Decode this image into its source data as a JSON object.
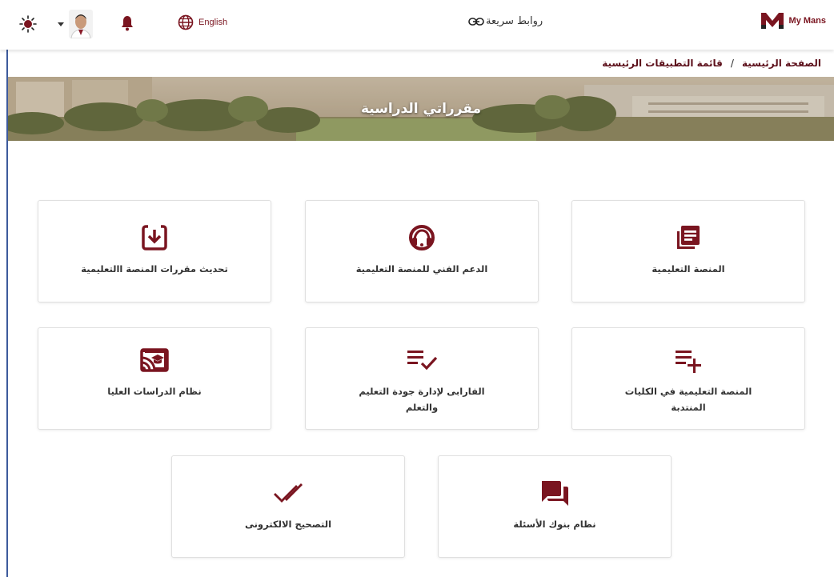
{
  "header": {
    "language_label": "English",
    "quick_links_label": "روابط سريعة",
    "logo_text": "My Mans",
    "icons": [
      "sun-icon",
      "avatar",
      "bell-icon",
      "globe-icon",
      "link-icon"
    ]
  },
  "breadcrumb": {
    "home": "الصفحة الرئيسية",
    "separator": "/",
    "current": "قائمة التطبيقات الرئيسية"
  },
  "banner": {
    "title": "مقرراتي الدراسية"
  },
  "cards": [
    {
      "label": "المنصة التعليمية",
      "icon": "document-icon"
    },
    {
      "label": "الدعم الفني للمنصة التعليمية",
      "icon": "headset-icon"
    },
    {
      "label": "تحديث مقررات المنصة االتعليمية",
      "icon": "download-box-icon"
    },
    {
      "label": "المنصة التعليمية في الكليات المنتدبة",
      "icon": "playlist-add-icon"
    },
    {
      "label": "الفارابى لإدارة جودة التعليم والتعلم",
      "icon": "playlist-check-icon"
    },
    {
      "label": "نظام الدراسات العليا",
      "icon": "cast-education-icon"
    },
    {
      "label": "نظام بنوك الأسئلة",
      "icon": "forum-icon"
    },
    {
      "label": "التصحيح الالكترونى",
      "icon": "double-check-icon"
    }
  ],
  "colors": {
    "accent": "#7a1520",
    "breadcrumb": "#5c0f1a"
  }
}
